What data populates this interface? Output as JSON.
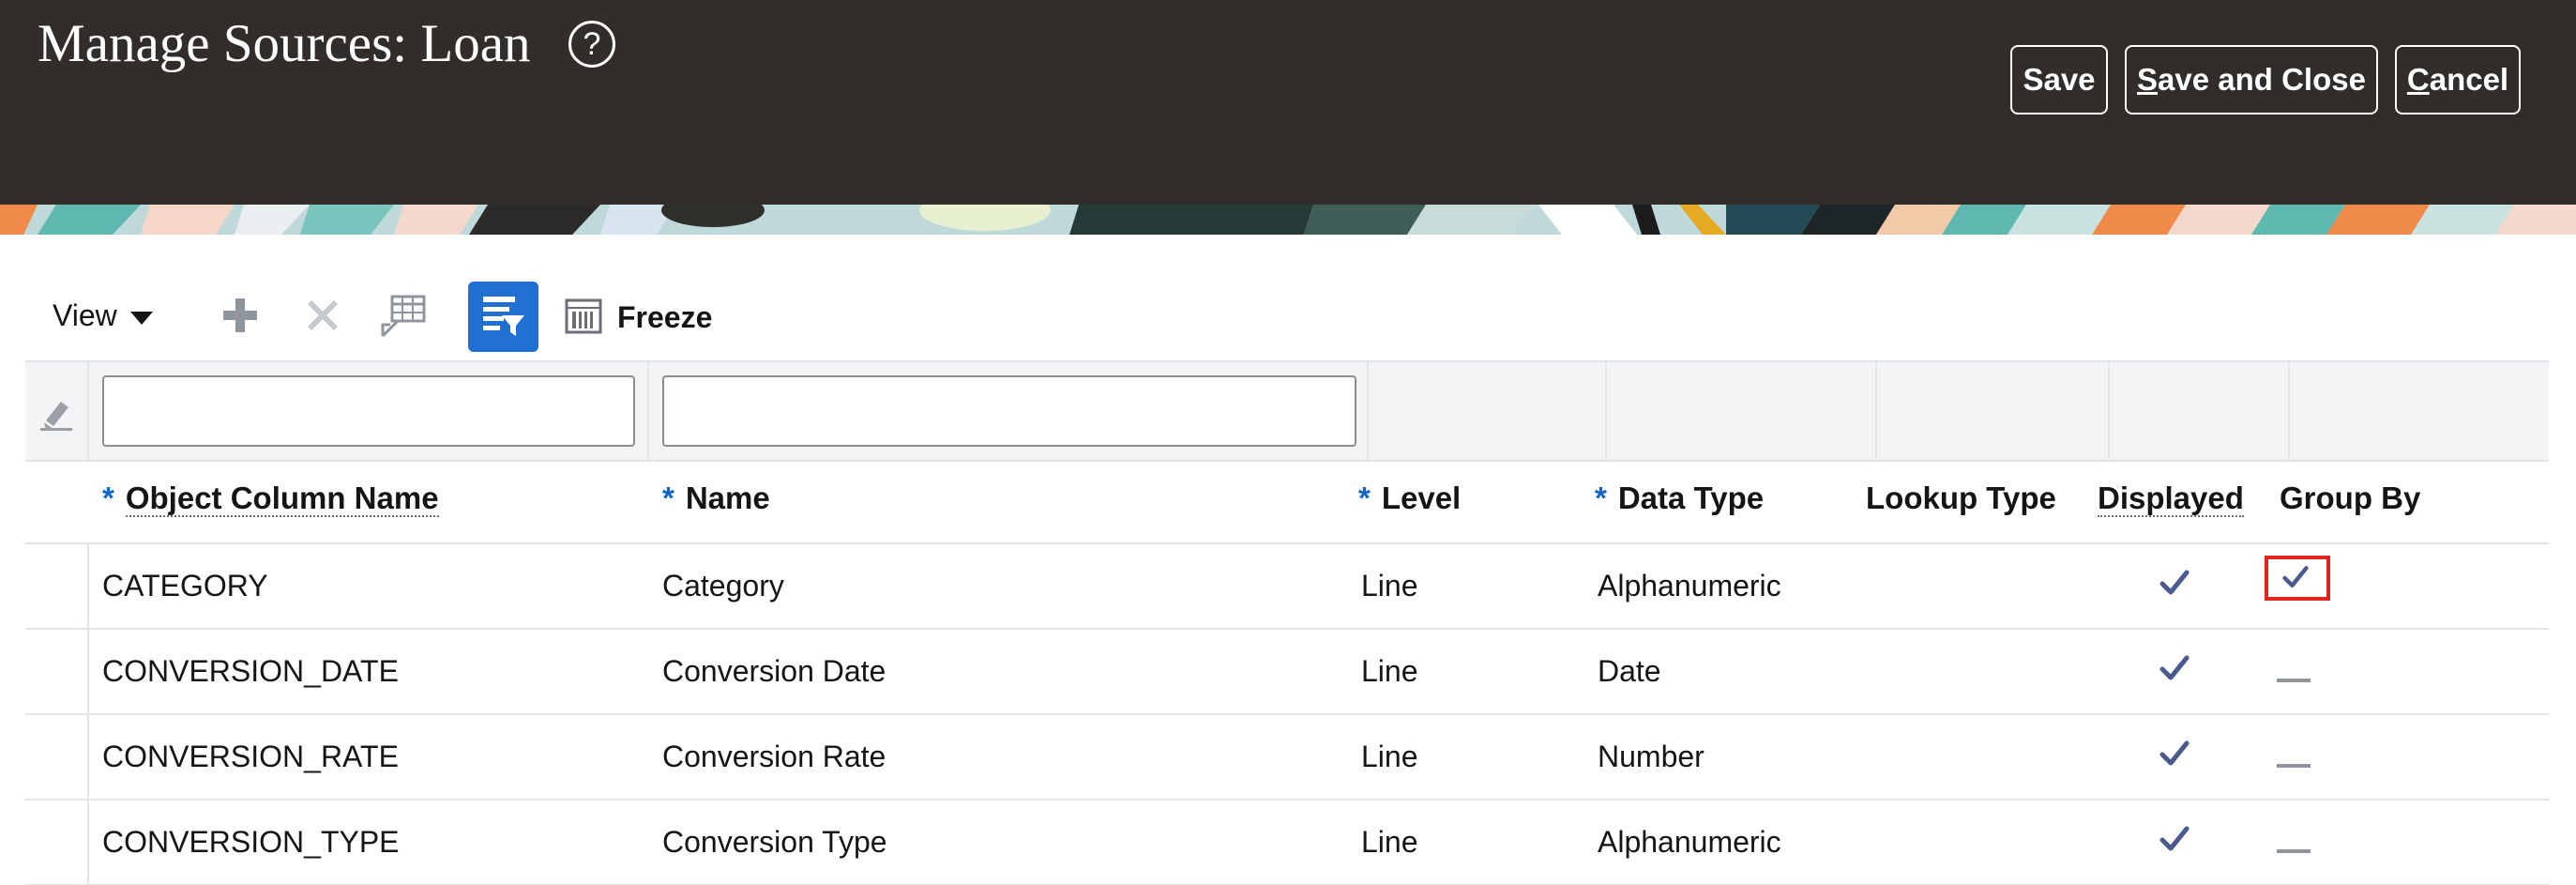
{
  "header": {
    "title": "Manage Sources: Loan",
    "help_glyph": "?",
    "buttons": {
      "save": "Save",
      "save_and_close": "Save and Close",
      "cancel": "Cancel"
    }
  },
  "toolbar": {
    "view_label": "View",
    "freeze_label": "Freeze",
    "icons": [
      "add-icon",
      "delete-icon",
      "detach-icon",
      "query-by-example-icon",
      "freeze-icon"
    ]
  },
  "table": {
    "required_marker": "*",
    "columns": [
      {
        "label": "Object Column Name",
        "required": true,
        "sortable": true
      },
      {
        "label": "Name",
        "required": true,
        "sortable": false
      },
      {
        "label": "Level",
        "required": true,
        "sortable": false
      },
      {
        "label": "Data Type",
        "required": true,
        "sortable": false
      },
      {
        "label": "Lookup Type",
        "required": false,
        "sortable": false
      },
      {
        "label": "Displayed",
        "required": false,
        "sortable": true
      },
      {
        "label": "Group By",
        "required": false,
        "sortable": false
      }
    ],
    "rows": [
      {
        "object_column_name": "CATEGORY",
        "name": "Category",
        "level": "Line",
        "data_type": "Alphanumeric",
        "lookup_type": "",
        "displayed": true,
        "group_by": true
      },
      {
        "object_column_name": "CONVERSION_DATE",
        "name": "Conversion Date",
        "level": "Line",
        "data_type": "Date",
        "lookup_type": "",
        "displayed": true,
        "group_by": false
      },
      {
        "object_column_name": "CONVERSION_RATE",
        "name": "Conversion Rate",
        "level": "Line",
        "data_type": "Number",
        "lookup_type": "",
        "displayed": true,
        "group_by": false
      },
      {
        "object_column_name": "CONVERSION_TYPE",
        "name": "Conversion Type",
        "level": "Line",
        "data_type": "Alphanumeric",
        "lookup_type": "",
        "displayed": true,
        "group_by": false
      }
    ]
  },
  "colors": {
    "header_bg": "#312d2a",
    "accent_blue": "#1f70d0",
    "check_color": "#4a5a8f",
    "highlight_red": "#e0251f"
  }
}
